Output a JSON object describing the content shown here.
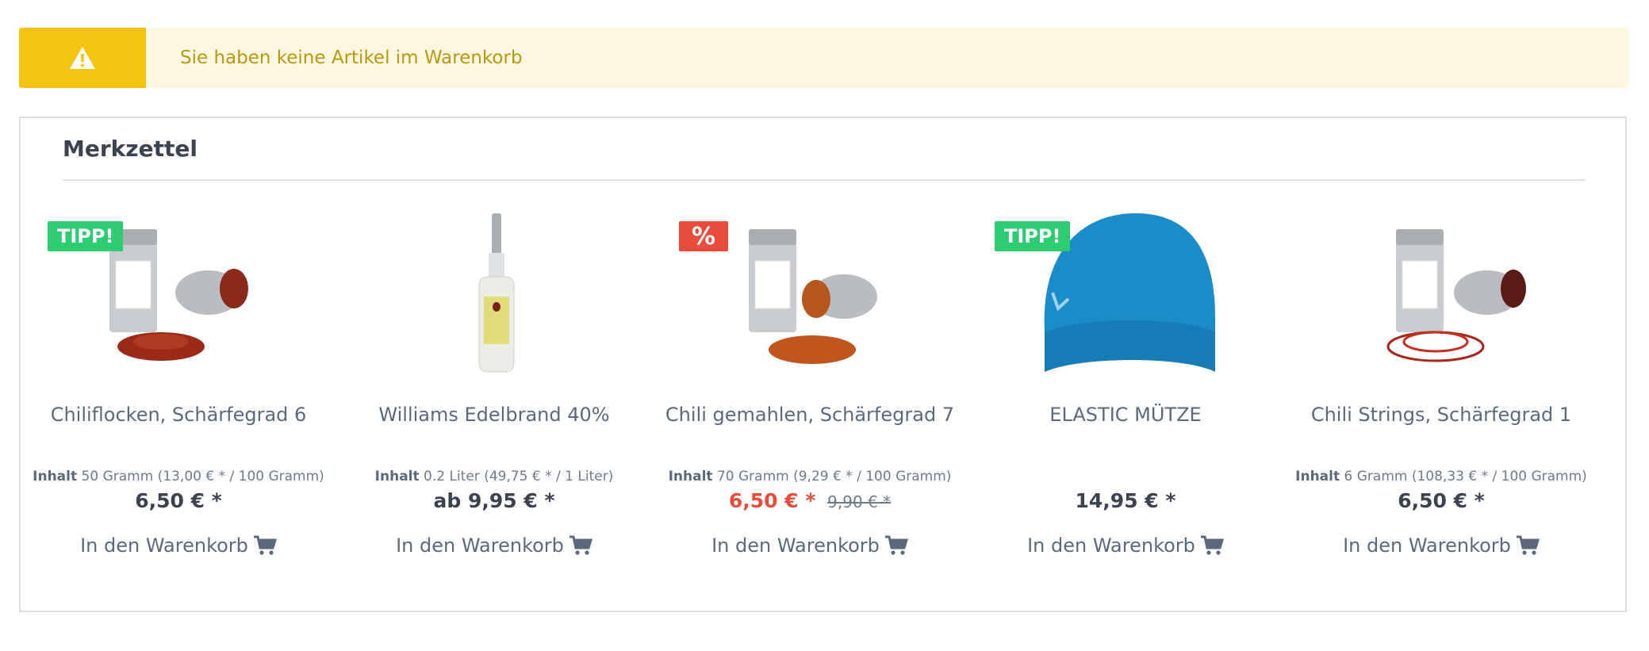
{
  "alert": {
    "message": "Sie haben keine Artikel im Warenkorb",
    "icon": "warning-icon",
    "color": "#f2c40f"
  },
  "wishlist": {
    "title": "Merkzettel",
    "products": [
      {
        "badge": "TIPP!",
        "badge_type": "tip",
        "image": "chili-flakes-tin",
        "name": "Chiliflocken, Schärfegrad 6",
        "content_label": "Inhalt",
        "content_value": "50 Gramm (13,00 € * / 100 Gramm)",
        "price": "6,50 € *",
        "old_price": "",
        "cart_label": "In den Warenkorb"
      },
      {
        "badge": "",
        "badge_type": "",
        "image": "brandy-bottle",
        "name": "Williams Edelbrand 40%",
        "content_label": "Inhalt",
        "content_value": "0.2 Liter (49,75 € * / 1 Liter)",
        "price": "ab 9,95 € *",
        "old_price": "",
        "cart_label": "In den Warenkorb"
      },
      {
        "badge": "%",
        "badge_type": "sale",
        "image": "chili-ground-tin",
        "name": "Chili gemahlen, Schärfegrad 7",
        "content_label": "Inhalt",
        "content_value": "70 Gramm (9,29 € * / 100 Gramm)",
        "price": "6,50 € *",
        "old_price": "9,90 € *",
        "cart_label": "In den Warenkorb"
      },
      {
        "badge": "TIPP!",
        "badge_type": "tip",
        "image": "blue-beanie",
        "name": "ELASTIC MÜTZE",
        "content_label": "",
        "content_value": "",
        "price": "14,95 € *",
        "old_price": "",
        "cart_label": "In den Warenkorb"
      },
      {
        "badge": "",
        "badge_type": "",
        "image": "chili-strings-tin",
        "name": "Chili Strings, Schärfegrad 1",
        "content_label": "Inhalt",
        "content_value": "6 Gramm (108,33 € * / 100 Gramm)",
        "price": "6,50 € *",
        "old_price": "",
        "cart_label": "In den Warenkorb"
      }
    ]
  },
  "colors": {
    "tip_badge": "#2ecc71",
    "sale_badge": "#e74c3c",
    "sale_price": "#e74c3c"
  }
}
